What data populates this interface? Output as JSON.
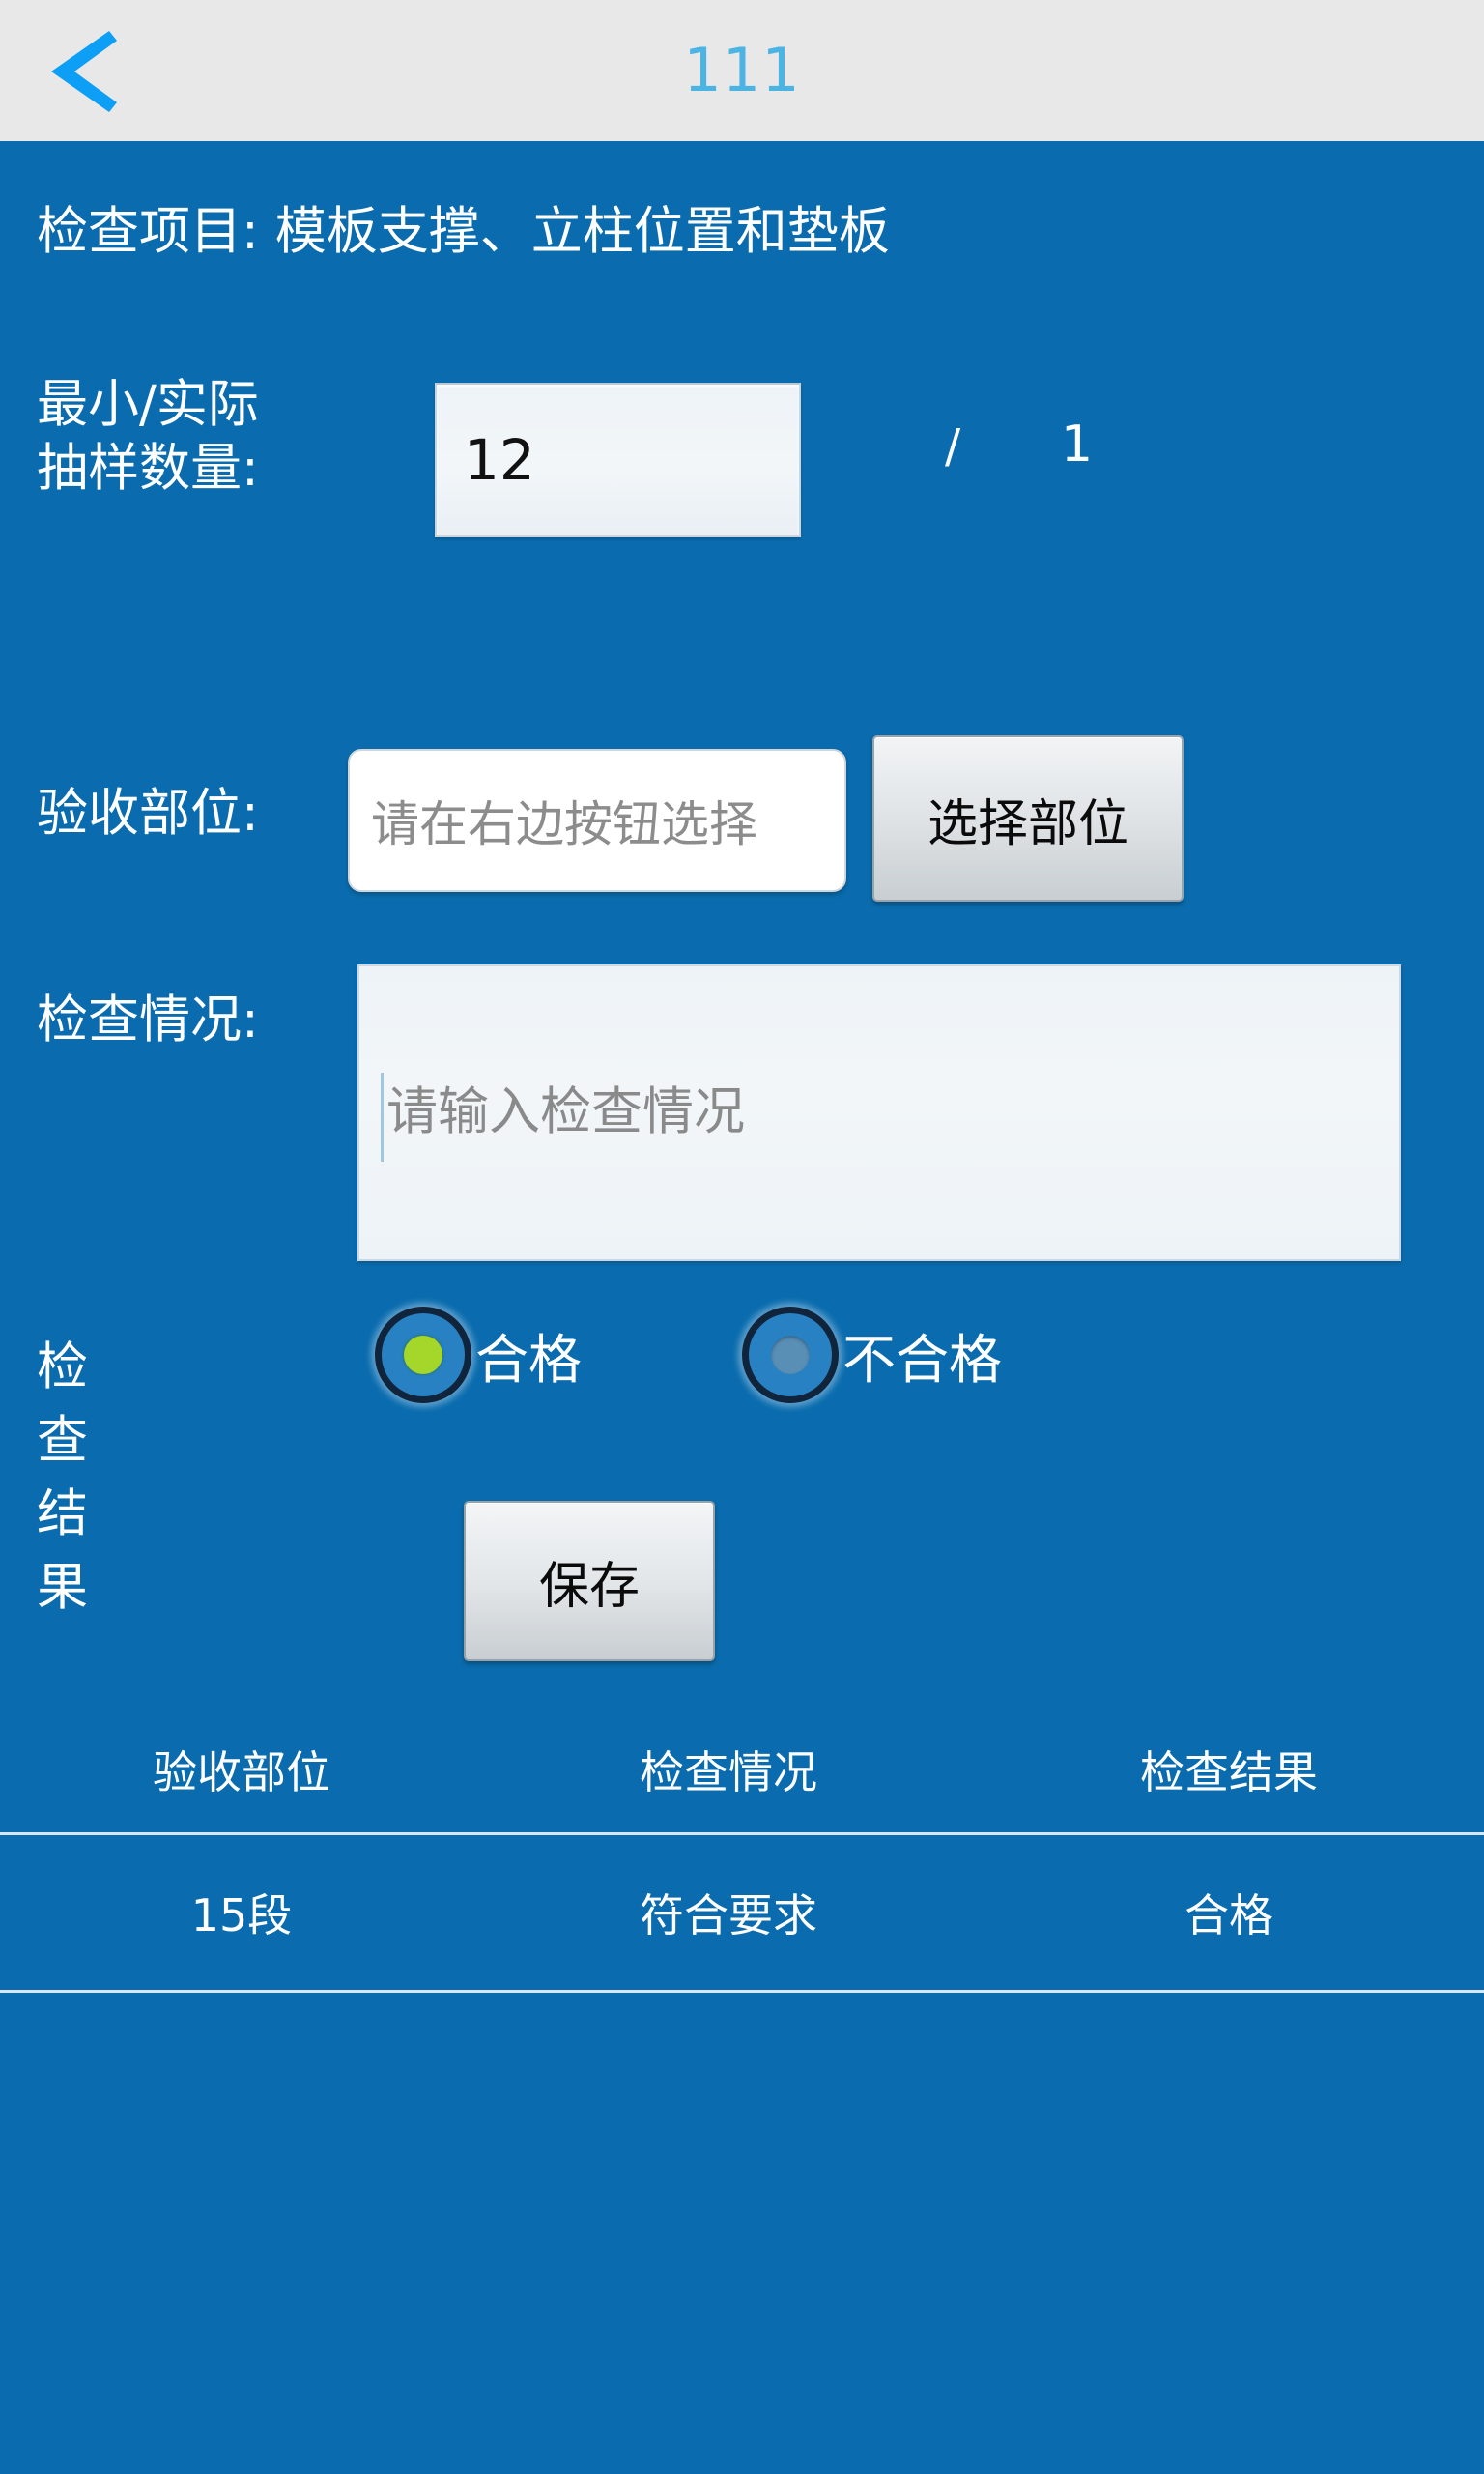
{
  "navbar": {
    "title": "111",
    "back_icon": "chevron-left-icon",
    "back_color": "#0d9ef5",
    "bg_color": "#e8e8e8",
    "title_color": "#4bb4e2"
  },
  "theme": {
    "page_bg": "#0a6cae",
    "label_color": "#ffffff",
    "accent_green": "#a5d62a",
    "input_bg": "#eef3f7"
  },
  "form": {
    "inspection_item": "检查项目: 模板支撑、立柱位置和垫板",
    "sample": {
      "label": "最小/实际\n抽样数量:",
      "label_line1": "最小/实际",
      "label_line2": "抽样数量:",
      "min_value": "12",
      "separator": "/",
      "actual_value": "1"
    },
    "position": {
      "label": "验收部位:",
      "value": "",
      "placeholder": "请在右边按钮选择",
      "select_button": "选择部位"
    },
    "situation": {
      "label": "检查情况:",
      "value": "",
      "placeholder": "请输入检查情况"
    },
    "result": {
      "label": "检查结果",
      "options": [
        {
          "label": "合格",
          "selected": true
        },
        {
          "label": "不合格",
          "selected": false
        }
      ]
    },
    "save_button": "保存"
  },
  "table": {
    "headers": [
      "验收部位",
      "检查情况",
      "检查结果"
    ],
    "rows": [
      {
        "position": "15段",
        "situation": "符合要求",
        "result": "合格"
      }
    ]
  }
}
